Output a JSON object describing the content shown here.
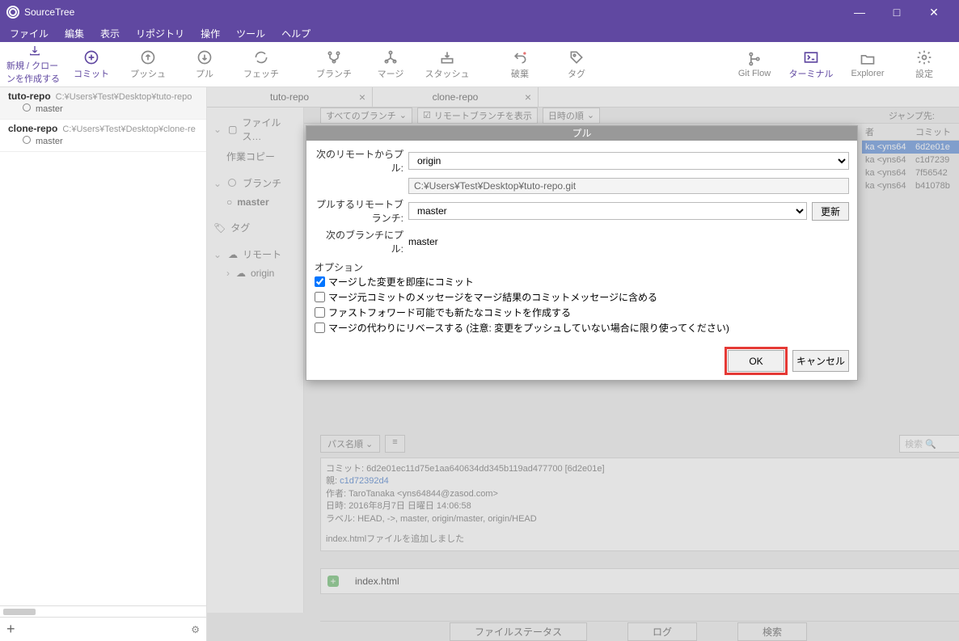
{
  "app": {
    "title": "SourceTree"
  },
  "window": {
    "min": "—",
    "max": "□",
    "close": "✕"
  },
  "menu": [
    "ファイル",
    "編集",
    "表示",
    "リポジトリ",
    "操作",
    "ツール",
    "ヘルプ"
  ],
  "toolbar": {
    "new_clone": "新規 / クローンを作成する",
    "commit": "コミット",
    "push": "プッシュ",
    "pull": "プル",
    "fetch": "フェッチ",
    "branch": "ブランチ",
    "merge": "マージ",
    "stash": "スタッシュ",
    "discard": "破棄",
    "tag": "タグ",
    "gitflow": "Git Flow",
    "terminal": "ターミナル",
    "explorer": "Explorer",
    "settings": "設定"
  },
  "repos": [
    {
      "name": "tuto-repo",
      "path": "C:¥Users¥Test¥Desktop¥tuto-repo",
      "branch": "master"
    },
    {
      "name": "clone-repo",
      "path": "C:¥Users¥Test¥Desktop¥clone-re",
      "branch": "master"
    }
  ],
  "tabs": [
    {
      "label": "tuto-repo"
    },
    {
      "label": "clone-repo"
    }
  ],
  "filter": {
    "all_branches": "すべてのブランチ",
    "show_remote": "リモートブランチを表示",
    "date_order": "日時の順",
    "jump": "ジャンプ先:"
  },
  "tree": {
    "file_status": "ファイルス…",
    "working_copy": "作業コピー",
    "branch": "ブランチ",
    "master": "master",
    "tag": "タグ",
    "remote": "リモート",
    "origin": "origin"
  },
  "commit_header": {
    "author": "者",
    "commit": "コミット"
  },
  "commits": [
    {
      "author": "ka <yns64",
      "hash": "6d2e01e"
    },
    {
      "author": "ka <yns64",
      "hash": "c1d7239"
    },
    {
      "author": "ka <yns64",
      "hash": "7f56542"
    },
    {
      "author": "ka <yns64",
      "hash": "b41078b"
    }
  ],
  "dialog": {
    "title": "プル",
    "remote_label": "次のリモートからプル:",
    "remote_value": "origin",
    "remote_path": "C:¥Users¥Test¥Desktop¥tuto-repo.git",
    "remote_branch_label": "プルするリモートブランチ:",
    "remote_branch_value": "master",
    "update": "更新",
    "local_branch_label": "次のブランチにプル:",
    "local_branch_value": "master",
    "options": "オプション",
    "opt1": "マージした変更を即座にコミット",
    "opt2": "マージ元コミットのメッセージをマージ結果のコミットメッセージに含める",
    "opt3": "ファストフォワード可能でも新たなコミットを作成する",
    "opt4": "マージの代わりにリベースする (注意: 変更をプッシュしていない場合に限り使ってください)",
    "ok": "OK",
    "cancel": "キャンセル"
  },
  "detail_bar": {
    "path_order": "パス名順",
    "view": "≡",
    "search": "検索",
    "gear": "⚙"
  },
  "commit_detail": {
    "commit": "コミット: 6d2e01ec11d75e1aa640634dd345b119ad477700 [6d2e01e]",
    "parent_label": "親: ",
    "parent": "c1d72392d4",
    "author": "作者: TaroTanaka <yns64844@zasod.com>",
    "date": "日時: 2016年8月7日 日曜日 14:06:58",
    "labels": "ラベル: HEAD, ->, master, origin/master, origin/HEAD",
    "msg": "index.htmlファイルを追加しました"
  },
  "file_change": "index.html",
  "bottom_tabs": {
    "file_status": "ファイルステータス",
    "log": "ログ",
    "search": "検索"
  }
}
